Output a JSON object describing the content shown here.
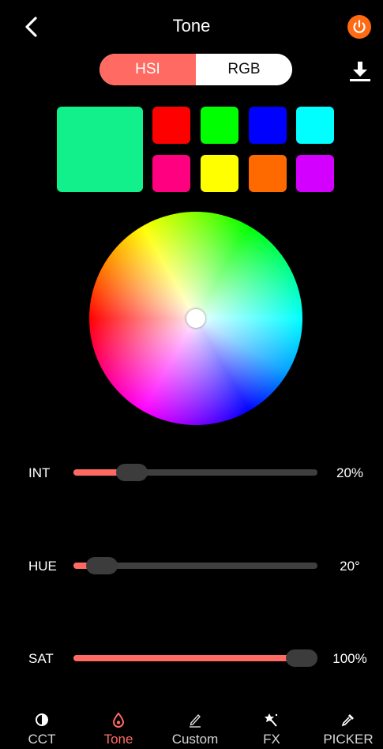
{
  "header": {
    "title": "Tone"
  },
  "mode_toggle": {
    "options": [
      "HSI",
      "RGB"
    ],
    "selected": "HSI"
  },
  "colors": {
    "accent": "#ff6b63",
    "power": "#ff6a13",
    "current": "#11f08a",
    "presets": [
      "#ff0000",
      "#00ff00",
      "#0000ff",
      "#00ffff",
      "#ff0080",
      "#ffff00",
      "#ff6a00",
      "#d400ff"
    ]
  },
  "sliders": {
    "int": {
      "label": "INT",
      "value": "20%",
      "level": 0.2
    },
    "hue": {
      "label": "HUE",
      "value": "20°",
      "level": 0.06
    },
    "sat": {
      "label": "SAT",
      "value": "100%",
      "level": 1.0
    }
  },
  "tabs": [
    {
      "label": "CCT",
      "icon": "half-circle-icon"
    },
    {
      "label": "Tone",
      "icon": "drop-icon"
    },
    {
      "label": "Custom",
      "icon": "pencil-icon"
    },
    {
      "label": "FX",
      "icon": "magic-wand-icon"
    },
    {
      "label": "PICKER",
      "icon": "eyedropper-icon"
    }
  ],
  "active_tab": "Tone"
}
